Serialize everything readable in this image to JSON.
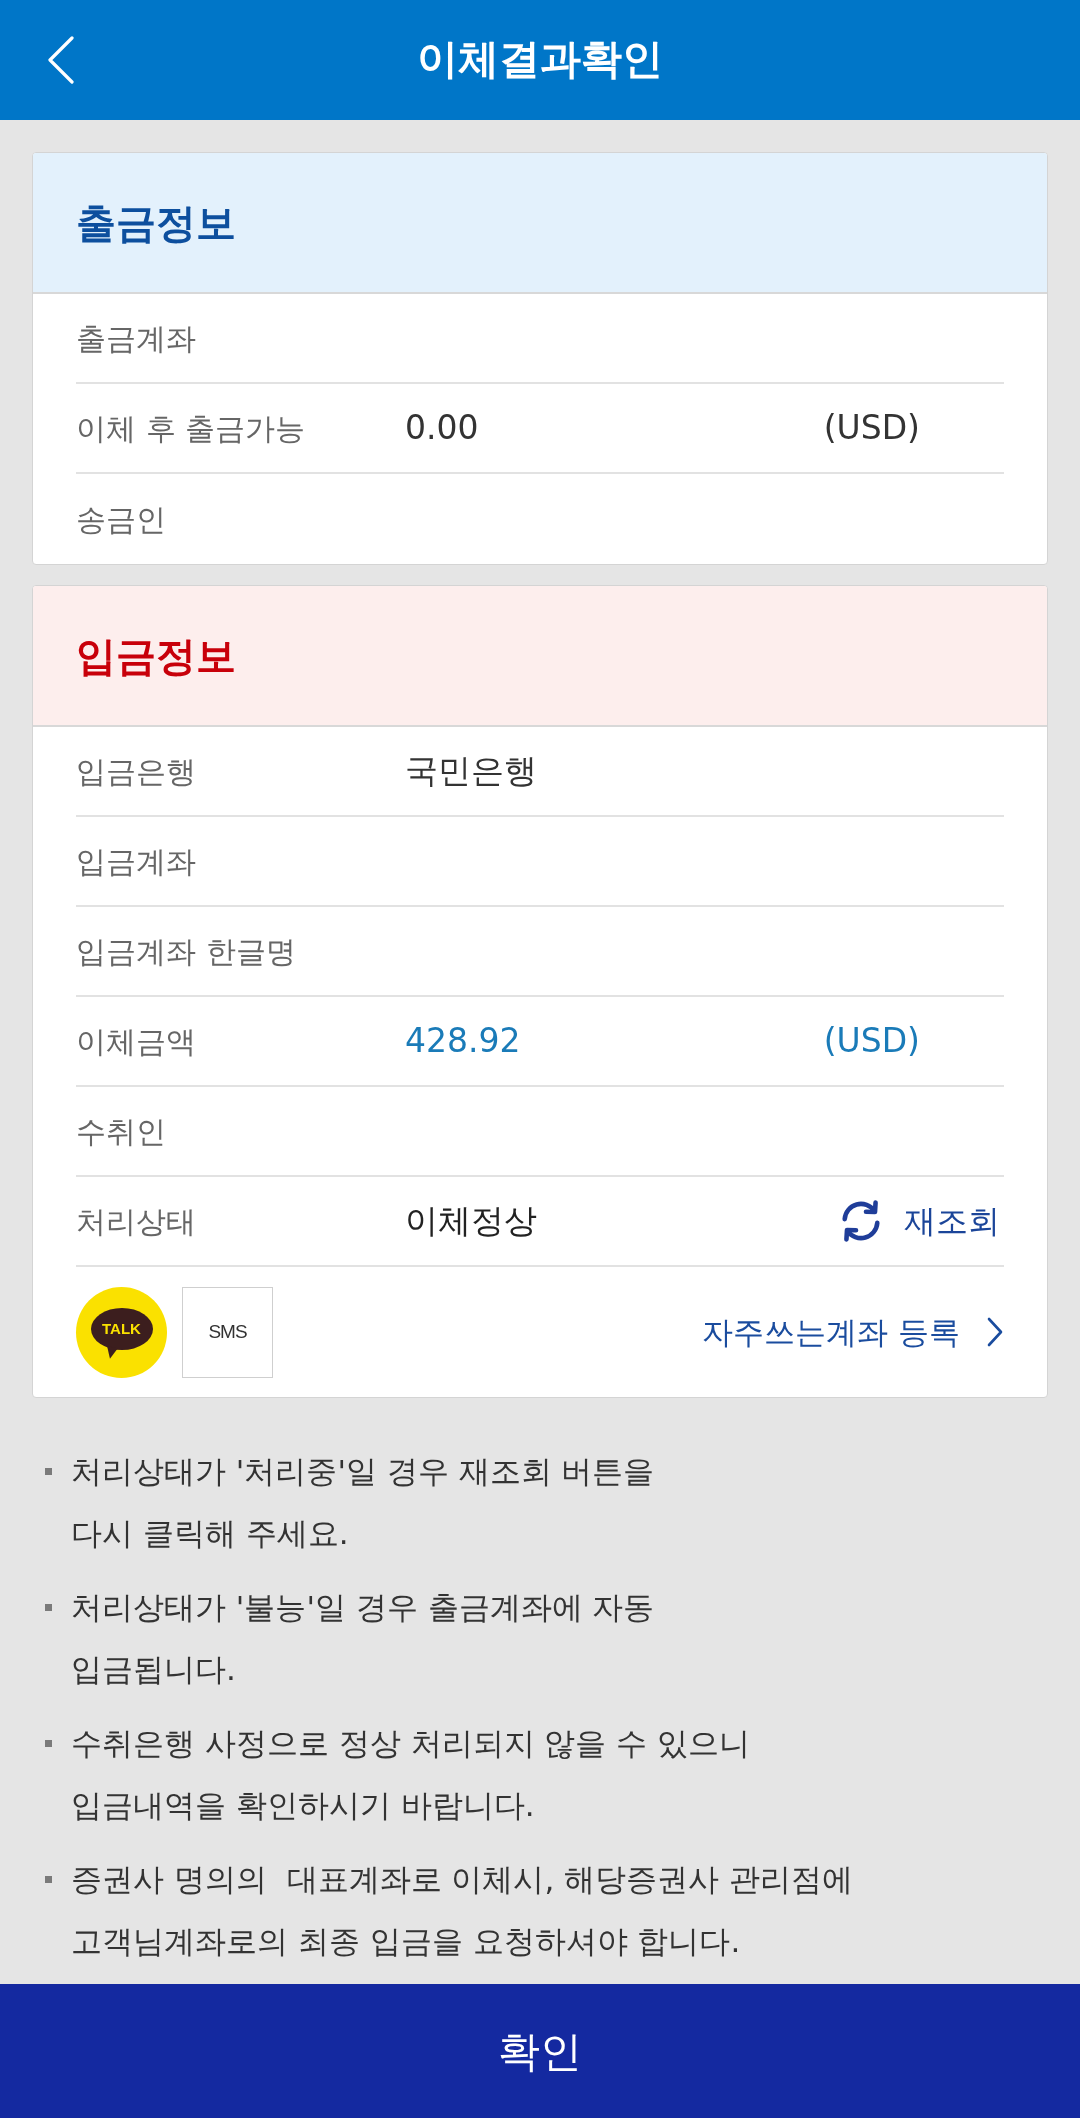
{
  "header": {
    "title": "이체결과확인"
  },
  "sections": [
    {
      "kind": "withdrawal",
      "title": "출금정보",
      "rows": [
        {
          "kind": "field",
          "label": "출금계좌"
        },
        {
          "kind": "field",
          "label": "이체 후 출금가능",
          "value": "0.00",
          "unit": "(USD)"
        },
        {
          "kind": "field",
          "label": "송금인"
        }
      ]
    },
    {
      "kind": "deposit",
      "title": "입금정보",
      "rows": [
        {
          "kind": "field",
          "label": "입금은행",
          "value": "국민은행"
        },
        {
          "kind": "field",
          "label": "입금계좌"
        },
        {
          "kind": "field",
          "label": "입금계좌 한글명"
        },
        {
          "kind": "amount",
          "label": "이체금액",
          "value": "428.92",
          "unit": "(USD)"
        },
        {
          "kind": "field",
          "label": "수취인"
        },
        {
          "kind": "status",
          "label": "처리상태",
          "value": "이체정상",
          "action": "재조회"
        }
      ],
      "share": {
        "talk": "TALK",
        "sms": "SMS",
        "link": "자주쓰는계좌 등록"
      }
    }
  ],
  "notes": [
    {
      "lines": [
        "처리상태가 '처리중'일 경우 재조회 버튼을",
        "다시 클릭해 주세요."
      ]
    },
    {
      "lines": [
        "처리상태가 '불능'일 경우 출금계좌에 자동",
        "입금됩니다."
      ]
    },
    {
      "lines": [
        "수취은행 사정으로 정상 처리되지 않을 수 있으니",
        "입금내역을 확인하시기 바랍니다."
      ]
    },
    {
      "lines": [
        "증권사 명의의  대표계좌로 이체시, 해당증권사 관리점에",
        "고객님계좌로의 최종 입금을 요청하셔야 합니다."
      ]
    }
  ],
  "confirm_button": "확인"
}
